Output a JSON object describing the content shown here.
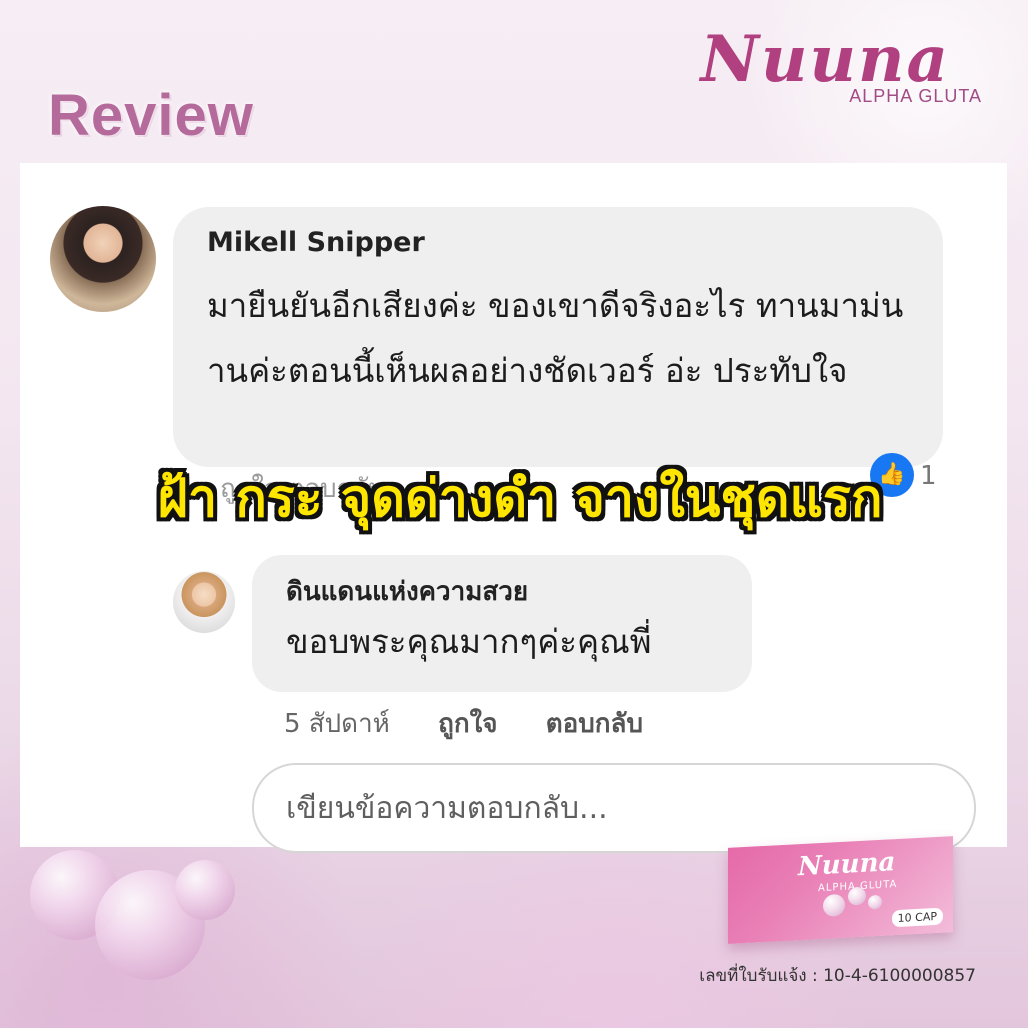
{
  "brand": {
    "name": "Nuuna",
    "subtitle": "ALPHA GLUTA"
  },
  "review_title": "Review",
  "comment": {
    "author": "Mikell Snipper",
    "text": "มายืนยันอีกเสียงค่ะ ของเขาดีจริงอะไร ทานมาม่นานค่ะตอนนี้เห็นผลอย่างชัดเวอร์ อ่ะ ประทับใจ",
    "partially_hidden_meta": "ถูกใจ   ตอบกลับ",
    "like_icon": "like-thumb-icon",
    "like_count": "1"
  },
  "reply": {
    "author": "ดินแดนแห่งความสวย",
    "text": "ขอบพระคุณมากๆค่ะคุณพี่",
    "time": "5 สัปดาห์",
    "like_action": "ถูกใจ",
    "reply_action": "ตอบกลับ"
  },
  "reply_input": {
    "placeholder": "เขียนข้อความตอบกลับ..."
  },
  "overlay_headline": "ฝ้า กระ จุดด่างดำ จางในชุดแรก",
  "product": {
    "brand": "Nuuna",
    "subtitle": "ALPHA GLUTA",
    "count": "10 CAP"
  },
  "license": "เลขที่ใบรับแจ้ง : 10-4-6100000857",
  "colors": {
    "brand": "#b0407f",
    "headline": "#ffe600",
    "facebook_blue": "#1877f2"
  }
}
